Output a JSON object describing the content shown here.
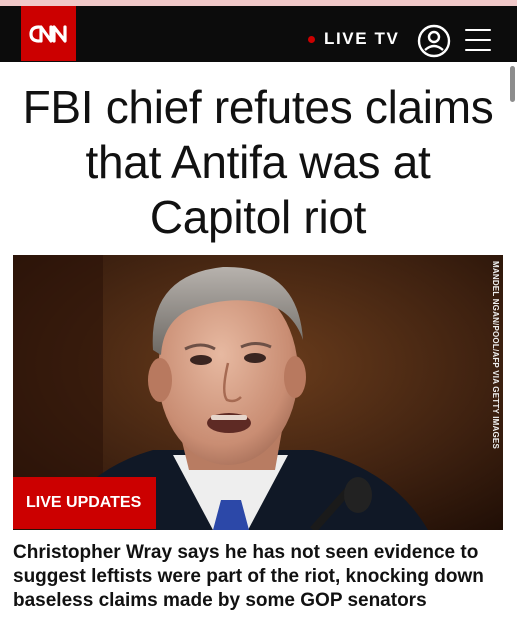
{
  "header": {
    "logo_text": "CNN",
    "live_label": "LIVE TV",
    "icons": [
      "user-account-icon",
      "hamburger-menu-icon"
    ],
    "colors": {
      "bar": "#0c0c0c",
      "brand_red": "#cc0000"
    }
  },
  "article": {
    "headline": "FBI chief refutes claims that Antifa was at Capitol riot",
    "image_credit": "MANDEL NGAN/POOL/AFP VIA GETTY IMAGES",
    "badge": "LIVE UPDATES",
    "summary": "Christopher Wray says he has not seen evidence to suggest leftists were part of the riot, knocking down baseless claims made by some GOP senators"
  }
}
